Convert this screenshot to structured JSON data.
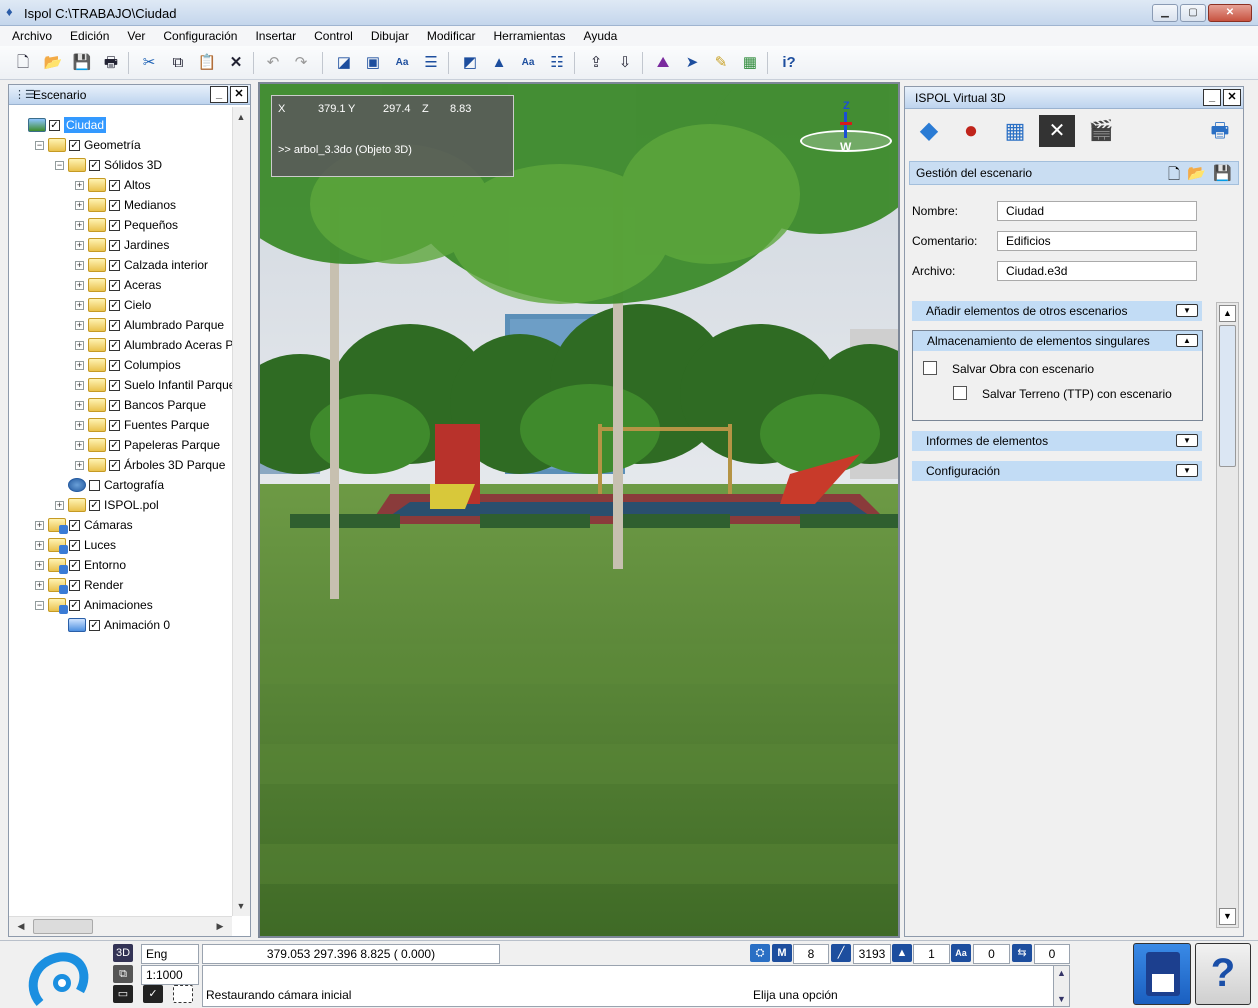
{
  "window": {
    "title": "Ispol  C:\\TRABAJO\\Ciudad",
    "minimize": "▁",
    "maximize": "▢",
    "close": "✕"
  },
  "menu": [
    "Archivo",
    "Edición",
    "Ver",
    "Configuración",
    "Insertar",
    "Control",
    "Dibujar",
    "Modificar",
    "Herramientas",
    "Ayuda"
  ],
  "toolbar": {
    "icons": [
      "new-file-icon",
      "open-folder-icon",
      "save-icon",
      "print-icon",
      "cut-icon",
      "copy-icon",
      "paste-icon",
      "delete-icon",
      "undo-icon",
      "redo-icon",
      "view-front-icon",
      "view-top-icon",
      "view-text-icon",
      "view-layers-icon",
      "view-front-2-icon",
      "view-top-2-icon",
      "view-text-2-icon",
      "view-layers-2-icon",
      "export-icon",
      "import-icon",
      "terrain-icon",
      "send-icon",
      "pen-icon",
      "render-icon",
      "help-icon"
    ]
  },
  "scene_panel": {
    "title": "Escenario",
    "tree": [
      {
        "label": "Ciudad",
        "level": 0,
        "checked": true,
        "selected": true,
        "expander": "",
        "icon": "landscape-icon"
      },
      {
        "label": "Geometría",
        "level": 1,
        "checked": true,
        "expander": "−",
        "icon": "folder-icon"
      },
      {
        "label": "Sólidos 3D",
        "level": 2,
        "checked": true,
        "expander": "−",
        "icon": "folder-icon"
      },
      {
        "label": "Altos",
        "level": 3,
        "checked": true,
        "expander": "+",
        "icon": "folder-icon"
      },
      {
        "label": "Medianos",
        "level": 3,
        "checked": true,
        "expander": "+",
        "icon": "folder-icon"
      },
      {
        "label": "Pequeños",
        "level": 3,
        "checked": true,
        "expander": "+",
        "icon": "folder-icon"
      },
      {
        "label": "Jardines",
        "level": 3,
        "checked": true,
        "expander": "+",
        "icon": "folder-icon"
      },
      {
        "label": "Calzada interior",
        "level": 3,
        "checked": true,
        "expander": "+",
        "icon": "folder-icon"
      },
      {
        "label": "Aceras",
        "level": 3,
        "checked": true,
        "expander": "+",
        "icon": "folder-icon"
      },
      {
        "label": "Cielo",
        "level": 3,
        "checked": true,
        "expander": "+",
        "icon": "folder-icon"
      },
      {
        "label": "Alumbrado Parque",
        "level": 3,
        "checked": true,
        "expander": "+",
        "icon": "folder-icon"
      },
      {
        "label": "Alumbrado Aceras Parque",
        "level": 3,
        "checked": true,
        "expander": "+",
        "icon": "folder-icon"
      },
      {
        "label": "Columpios",
        "level": 3,
        "checked": true,
        "expander": "+",
        "icon": "folder-icon"
      },
      {
        "label": "Suelo Infantil Parque",
        "level": 3,
        "checked": true,
        "expander": "+",
        "icon": "folder-icon"
      },
      {
        "label": "Bancos Parque",
        "level": 3,
        "checked": true,
        "expander": "+",
        "icon": "folder-icon"
      },
      {
        "label": "Fuentes Parque",
        "level": 3,
        "checked": true,
        "expander": "+",
        "icon": "folder-icon"
      },
      {
        "label": "Papeleras Parque",
        "level": 3,
        "checked": true,
        "expander": "+",
        "icon": "folder-icon"
      },
      {
        "label": "Árboles 3D Parque",
        "level": 3,
        "checked": true,
        "expander": "+",
        "icon": "folder-icon"
      },
      {
        "label": "Cartografía",
        "level": 2,
        "checked": false,
        "expander": "",
        "icon": "cartography-icon"
      },
      {
        "label": "ISPOL.pol",
        "level": 2,
        "checked": true,
        "expander": "+",
        "icon": "folder-icon"
      },
      {
        "label": "Cámaras",
        "level": 1,
        "checked": true,
        "expander": "+",
        "icon": "folder-icon"
      },
      {
        "label": "Luces",
        "level": 1,
        "checked": true,
        "expander": "+",
        "icon": "folder-icon"
      },
      {
        "label": "Entorno",
        "level": 1,
        "checked": true,
        "expander": "+",
        "icon": "folder-icon"
      },
      {
        "label": "Render",
        "level": 1,
        "checked": true,
        "expander": "+",
        "icon": "folder-icon"
      },
      {
        "label": "Animaciones",
        "level": 1,
        "checked": true,
        "expander": "−",
        "icon": "folder-icon"
      },
      {
        "label": "Animación 0",
        "level": 2,
        "checked": true,
        "expander": "",
        "icon": "animation-icon"
      }
    ]
  },
  "viewport": {
    "x_label": "X",
    "x_value": "379.1",
    "y_label": "Y",
    "y_value": "297.4",
    "z_label": "Z",
    "z_value": "8.83",
    "message": ">> arbol_3.3do (Objeto 3D)",
    "compass_z": "Z",
    "compass_w": "W"
  },
  "right_panel": {
    "title": "ISPOL Virtual 3D",
    "section_title": "Gestión del escenario",
    "fields": [
      {
        "label": "Nombre:",
        "value": "Ciudad"
      },
      {
        "label": "Comentario:",
        "value": "Edificios"
      },
      {
        "label": "Archivo:",
        "value": "Ciudad.e3d"
      }
    ],
    "sections": [
      {
        "label": "Añadir elementos de otros escenarios",
        "arrow": "▼"
      },
      {
        "label": "Almacenamiento de elementos singulares",
        "arrow": "▲"
      },
      {
        "label": "Informes de elementos",
        "arrow": "▼"
      },
      {
        "label": "Configuración",
        "arrow": "▼"
      }
    ],
    "options": [
      {
        "label": "Salvar Obra con escenario",
        "checked": false
      },
      {
        "label": "Salvar Terreno (TTP) con escenario",
        "checked": false
      }
    ]
  },
  "status": {
    "mode_3d": "3D",
    "mode": "Eng Libre",
    "scale": "1:1000",
    "coords": "379.053      297.396      8.825 (     0.000)",
    "m_value": "8",
    "line_value": "3193",
    "tri_value": "1",
    "text_value": "0",
    "layer_value": "0",
    "message_left": "Restaurando cámara inicial",
    "message_right": "Elija una opción"
  }
}
